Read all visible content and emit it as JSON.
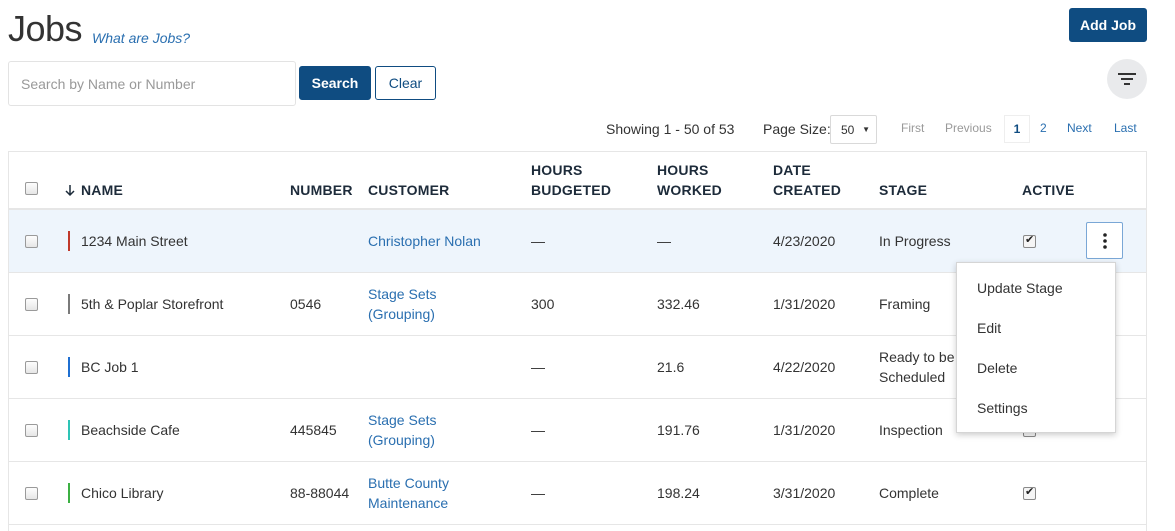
{
  "page": {
    "title": "Jobs",
    "help_link": "What are Jobs?"
  },
  "header": {
    "add_job_label": "Add Job"
  },
  "search": {
    "placeholder": "Search by Name or Number",
    "value": "",
    "search_label": "Search",
    "clear_label": "Clear",
    "filter_icon": "filter-icon"
  },
  "pagination": {
    "showing": "Showing 1 - 50 of 53",
    "page_size_label": "Page Size:",
    "page_size": "50",
    "first": "First",
    "previous": "Previous",
    "current": "1",
    "page2": "2",
    "next": "Next",
    "last": "Last"
  },
  "table": {
    "headers": {
      "name": "NAME",
      "number": "NUMBER",
      "customer": "CUSTOMER",
      "hours_budgeted_1": "HOURS",
      "hours_budgeted_2": "BUDGETED",
      "hours_worked_1": "HOURS",
      "hours_worked_2": "WORKED",
      "date_created_1": "DATE",
      "date_created_2": "CREATED",
      "stage": "STAGE",
      "active": "ACTIVE"
    },
    "sort_icon": "arrow-down-icon",
    "rows": [
      {
        "name": "1234 Main Street",
        "number": "",
        "customer1": "Christopher Nolan",
        "customer2": "",
        "budgeted": "—",
        "worked": "—",
        "created": "4/23/2020",
        "stage1": "In Progress",
        "stage2": "",
        "active": true,
        "color": "#c0392b"
      },
      {
        "name": "5th & Poplar Storefront",
        "number": "0546",
        "customer1": "Stage Sets",
        "customer2": "(Grouping)",
        "budgeted": "300",
        "worked": "332.46",
        "created": "1/31/2020",
        "stage1": "Framing",
        "stage2": "",
        "active": true,
        "color": "#7a7a7a"
      },
      {
        "name": "BC Job 1",
        "number": "",
        "customer1": "",
        "customer2": "",
        "budgeted": "—",
        "worked": "21.6",
        "created": "4/22/2020",
        "stage1": "Ready to be",
        "stage2": "Scheduled",
        "active": true,
        "color": "#1f6fd1"
      },
      {
        "name": "Beachside Cafe",
        "number": "445845",
        "customer1": "Stage Sets",
        "customer2": "(Grouping)",
        "budgeted": "—",
        "worked": "191.76",
        "created": "1/31/2020",
        "stage1": "Inspection",
        "stage2": "",
        "active": true,
        "color": "#2ec4b6"
      },
      {
        "name": "Chico Library",
        "number": "88-88044",
        "customer1": "Butte County",
        "customer2": "Maintenance",
        "budgeted": "—",
        "worked": "198.24",
        "created": "3/31/2020",
        "stage1": "Complete",
        "stage2": "",
        "active": true,
        "color": "#3cb043"
      }
    ]
  },
  "context_menu": {
    "items": [
      "Update Stage",
      "Edit",
      "Delete",
      "Settings"
    ]
  }
}
